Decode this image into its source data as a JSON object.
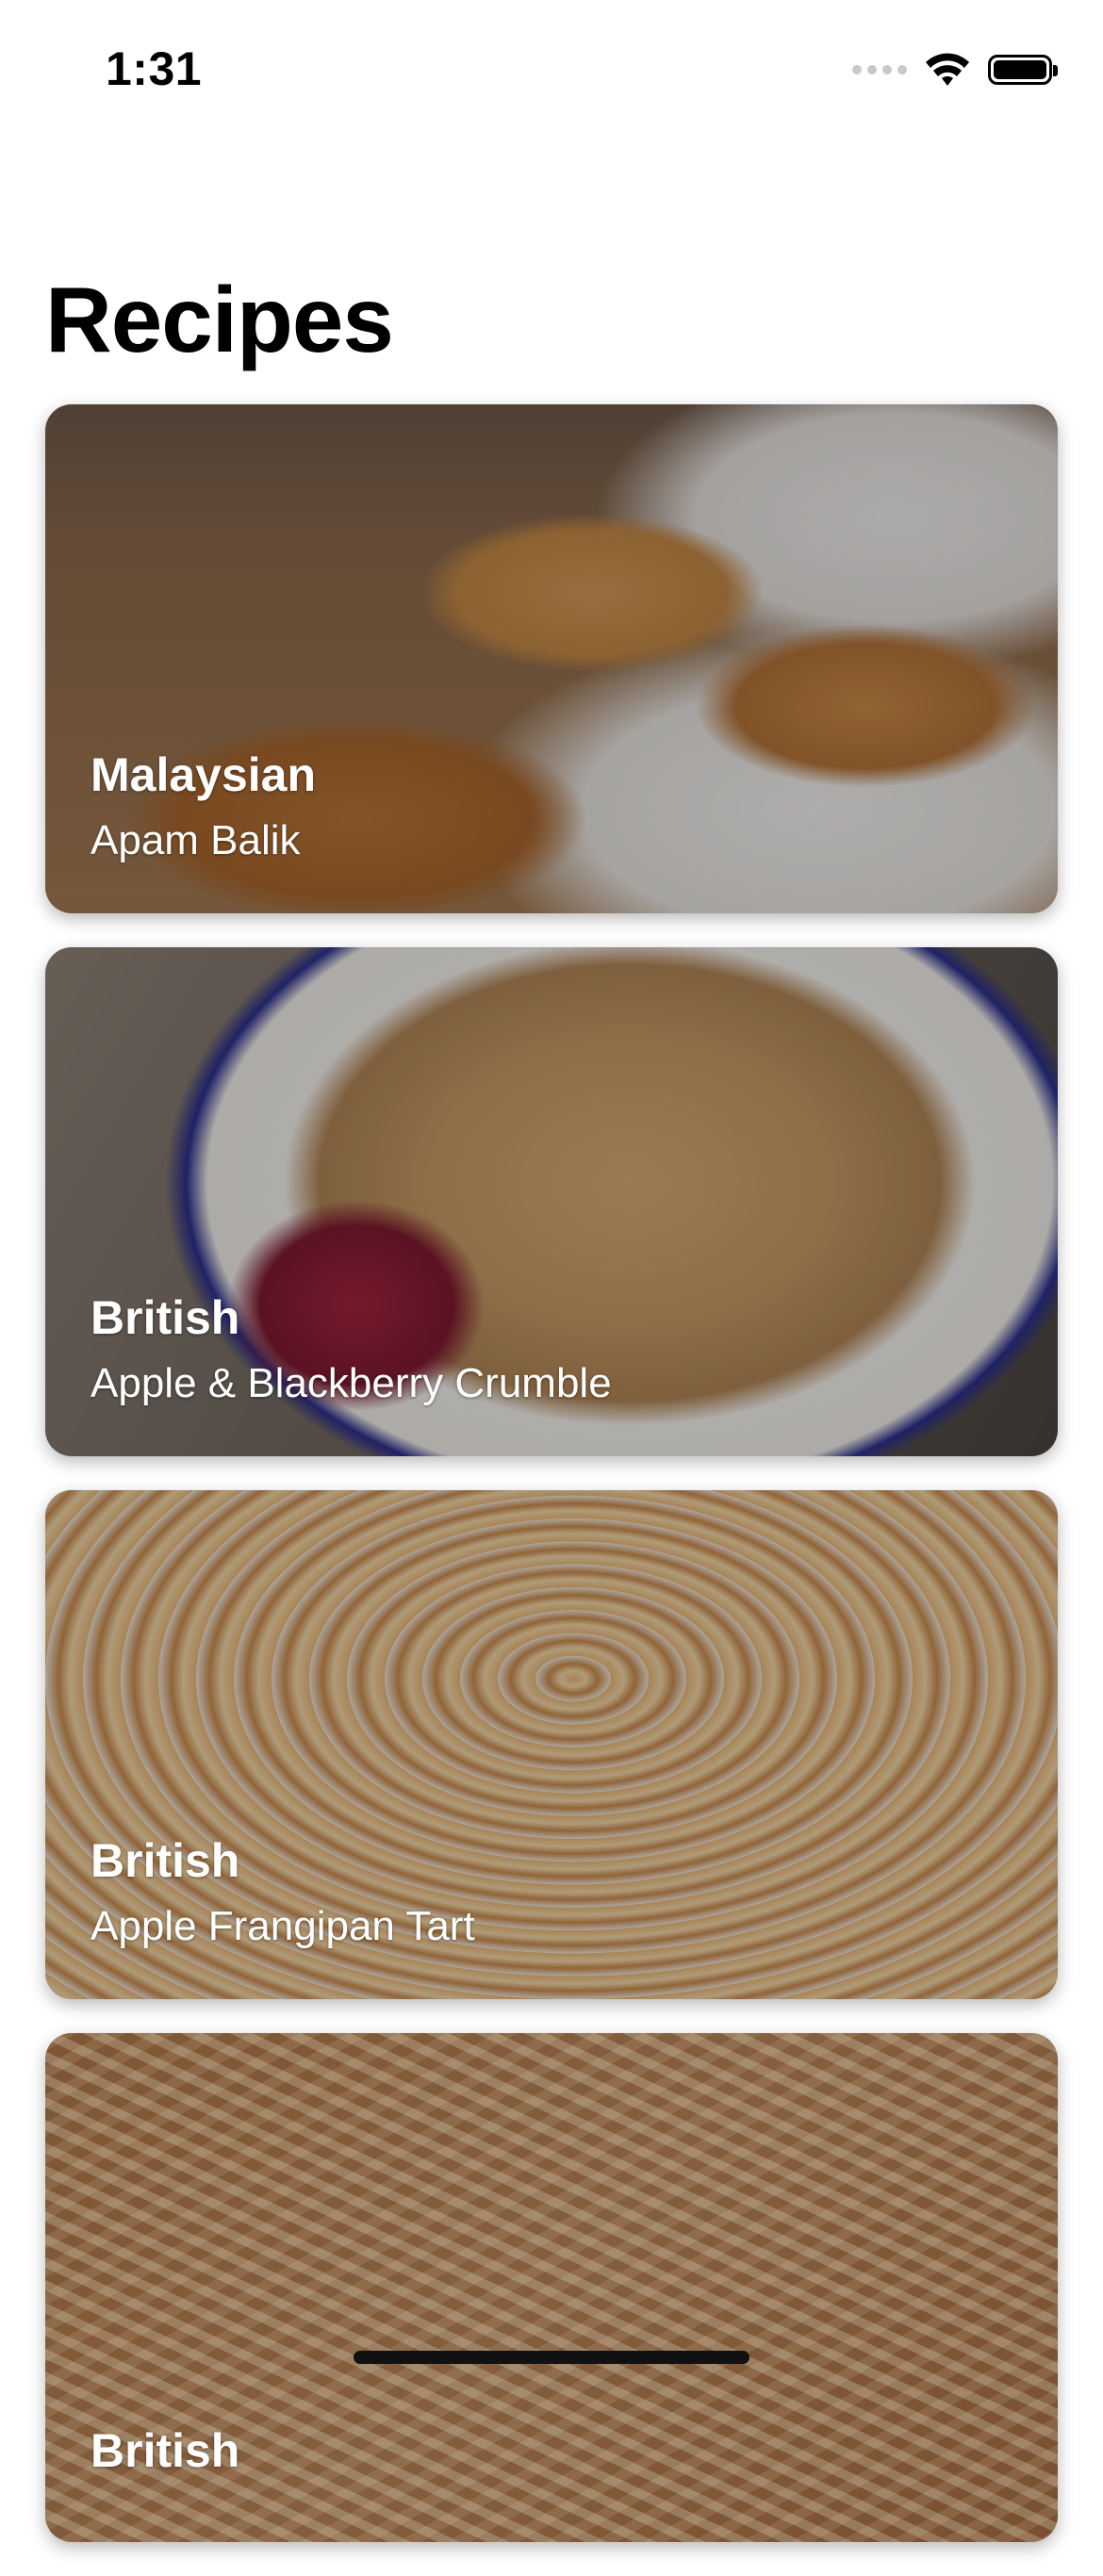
{
  "status_bar": {
    "time": "1:31",
    "icons": [
      "cellular-signal-icon",
      "wifi-icon",
      "battery-icon"
    ]
  },
  "title": "Recipes",
  "recipes": [
    {
      "cuisine": "Malaysian",
      "name": "Apam Balik"
    },
    {
      "cuisine": "British",
      "name": "Apple & Blackberry Crumble"
    },
    {
      "cuisine": "British",
      "name": "Apple Frangipan Tart"
    },
    {
      "cuisine": "British",
      "name": ""
    }
  ]
}
